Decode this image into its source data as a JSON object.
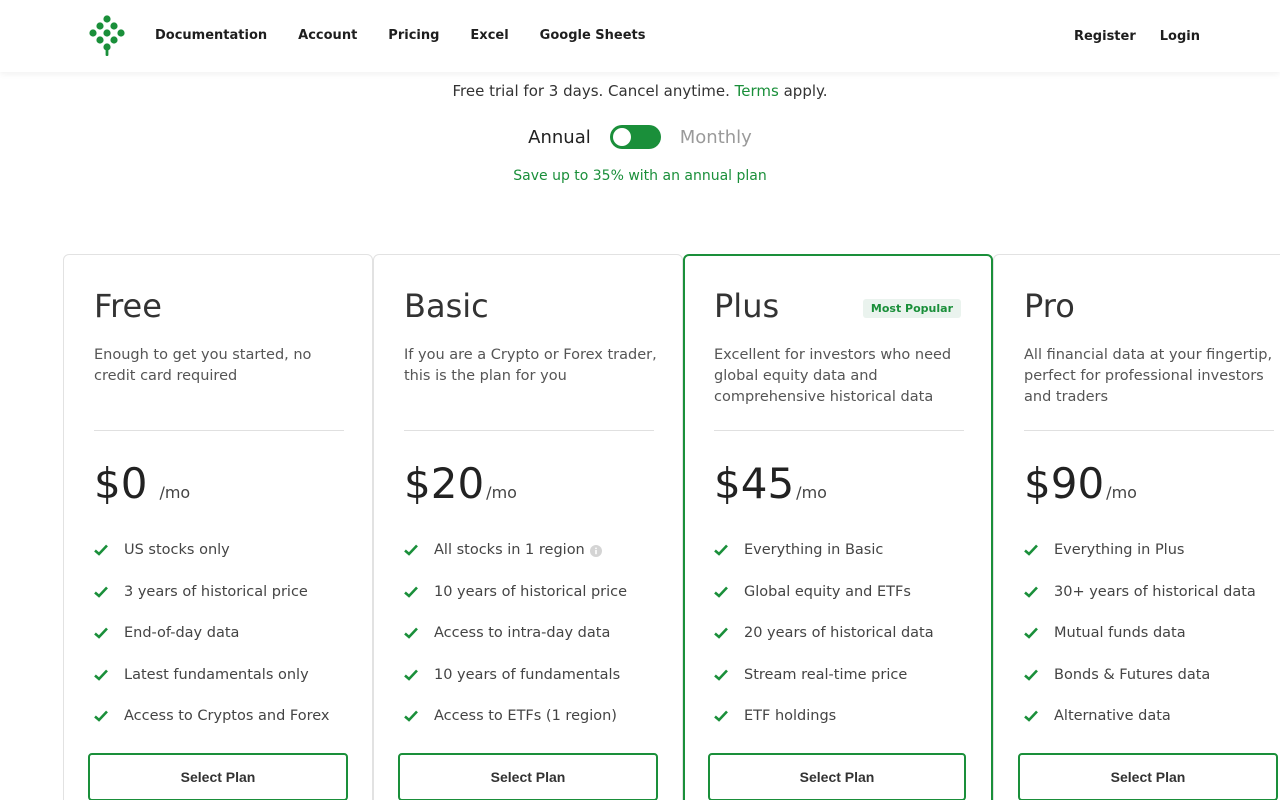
{
  "nav": {
    "items": [
      "Documentation",
      "Account",
      "Pricing",
      "Excel",
      "Google Sheets"
    ],
    "register": "Register",
    "login": "Login"
  },
  "trial": {
    "text_before": "Free trial for 3 days. Cancel anytime. ",
    "terms_link": "Terms",
    "text_after": " apply."
  },
  "billing": {
    "annual_label": "Annual",
    "monthly_label": "Monthly",
    "selected": "Annual",
    "save_note": "Save up to 35% with an annual plan"
  },
  "colors": {
    "accent": "#1a8f3a",
    "badge_bg": "#eaf3ee"
  },
  "plans": [
    {
      "name": "Free",
      "description": "Enough to get you started, no credit card required",
      "price": "$0",
      "period": "/mo",
      "features": [
        "US stocks only",
        "3 years of historical price",
        "End-of-day data",
        "Latest fundamentals only",
        "Access to Cryptos and Forex"
      ],
      "button": "Select Plan"
    },
    {
      "name": "Basic",
      "description": "If you are a Crypto or Forex trader, this is the plan for you",
      "price": "$20",
      "period": "/mo",
      "features": [
        "All stocks in 1 region",
        "10 years of historical price",
        "Access to intra-day data",
        "10 years of fundamentals",
        "Access to ETFs (1 region)"
      ],
      "button": "Select Plan"
    },
    {
      "name": "Plus",
      "badge": "Most Popular",
      "description": "Excellent for investors who need global equity data and comprehensive historical data",
      "price": "$45",
      "period": "/mo",
      "features": [
        "Everything in Basic",
        "Global equity and ETFs",
        "20 years of historical data",
        "Stream real-time price",
        "ETF holdings"
      ],
      "button": "Select Plan"
    },
    {
      "name": "Pro",
      "description": "All financial data at your fingertip, perfect for professional investors and traders",
      "price": "$90",
      "period": "/mo",
      "features": [
        "Everything in Plus",
        "30+ years of historical data",
        "Mutual funds data",
        "Bonds & Futures data",
        "Alternative data"
      ],
      "button": "Select Plan"
    }
  ]
}
